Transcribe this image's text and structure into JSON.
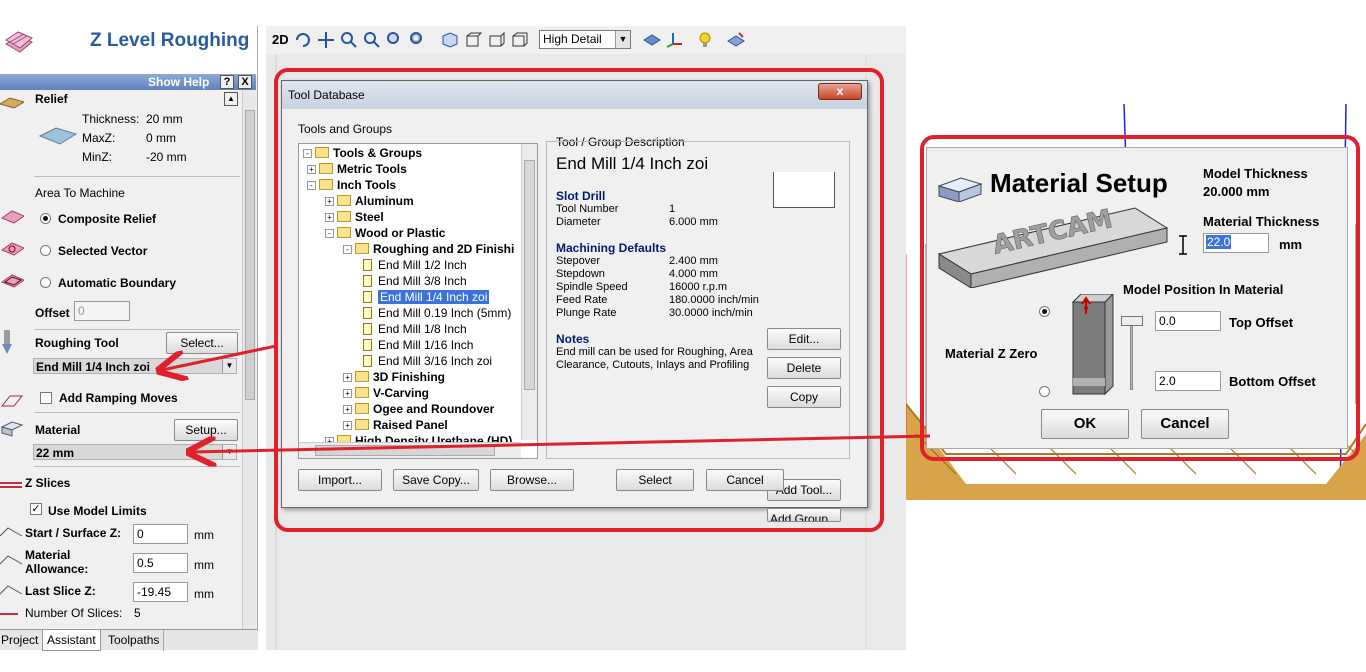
{
  "left_panel": {
    "title": "Z Level Roughing",
    "show_help": "Show Help",
    "help_q": "?",
    "help_close": "X",
    "relief": {
      "label": "Relief",
      "thickness_label": "Thickness:",
      "thickness_value": "20 mm",
      "maxz_label": "MaxZ:",
      "maxz_value": "0 mm",
      "minz_label": "MinZ:",
      "minz_value": "-20 mm"
    },
    "area": {
      "heading": "Area To Machine",
      "options": [
        "Composite Relief",
        "Selected Vector",
        "Automatic Boundary"
      ],
      "selected": "Composite Relief",
      "offset_label": "Offset",
      "offset_value": "0"
    },
    "roughing_tool": {
      "label": "Roughing Tool",
      "select_button": "Select...",
      "value": "End Mill 1/4 Inch zoi"
    },
    "ramping": {
      "label": "Add Ramping Moves",
      "checked": false
    },
    "material": {
      "label": "Material",
      "setup_button": "Setup...",
      "value": "22 mm"
    },
    "z_slices": {
      "heading": "Z Slices",
      "use_model_limits": "Use Model Limits",
      "use_model_limits_checked": true,
      "start_label": "Start / Surface Z:",
      "start_value": "0",
      "allowance_label": "Material\nAllowance:",
      "allowance_value": "0.5",
      "last_label": "Last Slice Z:",
      "last_value": "-19.45",
      "unit": "mm",
      "num_slices_label": "Number Of Slices:",
      "num_slices_value": "5"
    },
    "tabs": [
      "Project",
      "Assistant",
      "Toolpaths"
    ],
    "active_tab": "Assistant"
  },
  "toolbar": {
    "mode_2d": "2D",
    "detail_select": "High Detail",
    "icons": [
      "rotate-icon",
      "pan-icon",
      "zoom-in-icon",
      "zoom-out-icon",
      "zoom-fit-icon",
      "zoom-box-icon",
      "iso-view-icon",
      "top-view-icon",
      "front-view-icon",
      "side-view-icon",
      "shaded-view-icon",
      "axes-icon",
      "light-bulb-icon",
      "material-icon"
    ]
  },
  "tool_database": {
    "title": "Tool Database",
    "close": "x",
    "tools_and_groups": "Tools and Groups",
    "tree": [
      {
        "label": "Tools & Groups",
        "bold": true,
        "level": 0,
        "exp": "-",
        "icon": "folder"
      },
      {
        "label": "Metric Tools",
        "bold": true,
        "level": 1,
        "exp": "+",
        "icon": "folder"
      },
      {
        "label": "Inch Tools",
        "bold": true,
        "level": 1,
        "exp": "-",
        "icon": "folder"
      },
      {
        "label": "Aluminum",
        "bold": true,
        "level": 2,
        "exp": "+",
        "icon": "folder"
      },
      {
        "label": "Steel",
        "bold": true,
        "level": 2,
        "exp": "+",
        "icon": "folder"
      },
      {
        "label": "Wood or Plastic",
        "bold": true,
        "level": 2,
        "exp": "-",
        "icon": "folder"
      },
      {
        "label": "Roughing and 2D Finishi",
        "bold": true,
        "level": 3,
        "exp": "-",
        "icon": "folder"
      },
      {
        "label": "End Mill 1/2 Inch",
        "bold": false,
        "level": 4,
        "exp": "",
        "icon": "doc"
      },
      {
        "label": "End Mill 3/8 Inch",
        "bold": false,
        "level": 4,
        "exp": "",
        "icon": "doc"
      },
      {
        "label": "End Mill 1/4 Inch zoi",
        "bold": false,
        "level": 4,
        "exp": "",
        "icon": "doc",
        "selected": true
      },
      {
        "label": "End Mill 0.19 Inch (5mm)",
        "bold": false,
        "level": 4,
        "exp": "",
        "icon": "doc"
      },
      {
        "label": "End Mill 1/8 Inch",
        "bold": false,
        "level": 4,
        "exp": "",
        "icon": "doc"
      },
      {
        "label": "End Mill 1/16 Inch",
        "bold": false,
        "level": 4,
        "exp": "",
        "icon": "doc"
      },
      {
        "label": "End Mill 3/16 Inch zoi",
        "bold": false,
        "level": 4,
        "exp": "",
        "icon": "doc"
      },
      {
        "label": "3D Finishing",
        "bold": true,
        "level": 3,
        "exp": "+",
        "icon": "folder"
      },
      {
        "label": "V-Carving",
        "bold": true,
        "level": 3,
        "exp": "+",
        "icon": "folder"
      },
      {
        "label": "Ogee and Roundover",
        "bold": true,
        "level": 3,
        "exp": "+",
        "icon": "folder"
      },
      {
        "label": "Raised Panel",
        "bold": true,
        "level": 3,
        "exp": "+",
        "icon": "folder"
      },
      {
        "label": "High Density Urethane (HD)",
        "bold": true,
        "level": 2,
        "exp": "+",
        "icon": "folder"
      }
    ],
    "desc_group": "Tool / Group Description",
    "tool_name": "End Mill 1/4 Inch zoi",
    "type": "Slot Drill",
    "tool_number_label": "Tool Number",
    "tool_number": "1",
    "diameter_label": "Diameter",
    "diameter": "6.000 mm",
    "machining_defaults": "Machining Defaults",
    "stepover_label": "Stepover",
    "stepover": "2.400 mm",
    "stepdown_label": "Stepdown",
    "stepdown": "4.000 mm",
    "spindle_label": "Spindle Speed",
    "spindle": "16000 r.p.m",
    "feed_label": "Feed Rate",
    "feed": "180.0000 inch/min",
    "plunge_label": "Plunge Rate",
    "plunge": "30.0000 inch/min",
    "notes_heading": "Notes",
    "notes": "End mill can be used for Roughing, Area Clearance, Cutouts, Inlays and Profiling",
    "edit": "Edit...",
    "delete": "Delete",
    "copy": "Copy",
    "add_tool": "Add Tool...",
    "add_group": "Add Group...",
    "import": "Import...",
    "save_copy": "Save Copy...",
    "browse": "Browse...",
    "select": "Select",
    "cancel": "Cancel"
  },
  "material_setup": {
    "title": "Material Setup",
    "model_thickness_label": "Model Thickness",
    "model_thickness_value": "20.000 mm",
    "material_thickness_label": "Material Thickness",
    "material_thickness_value": "22.0",
    "unit": "mm",
    "position_heading": "Model Position In Material",
    "z_zero_label": "Material Z Zero",
    "top_offset_value": "0.0",
    "top_offset_label": "Top Offset",
    "bottom_offset_value": "2.0",
    "bottom_offset_label": "Bottom Offset",
    "ok": "OK",
    "cancel": "Cancel",
    "block_text": "ARTCAM"
  },
  "colors": {
    "annotation_red": "#e0202a",
    "title_blue": "#2c5aa0",
    "selection_blue": "#3b74d6",
    "section_navy": "#001a6e"
  }
}
